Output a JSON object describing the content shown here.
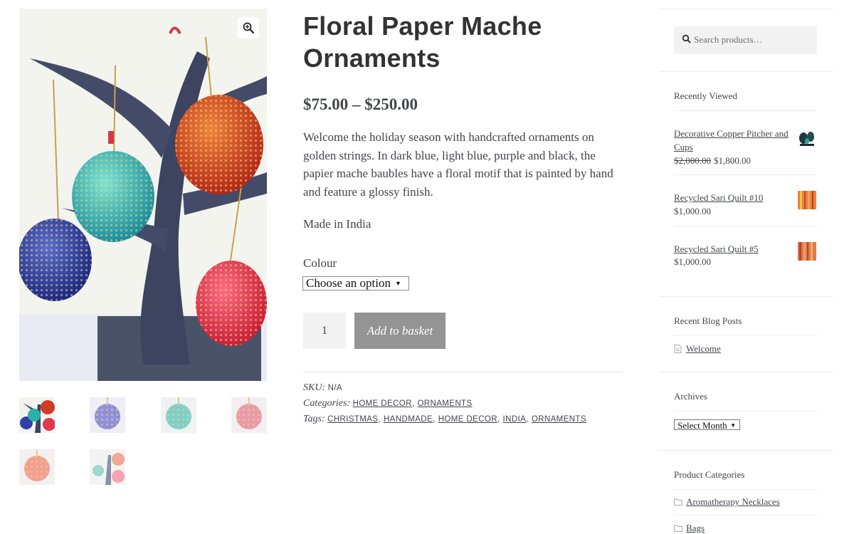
{
  "product": {
    "title_line1": "Floral Paper Mache",
    "title_line2": "Ornaments",
    "price": "$75.00 – $250.00",
    "description": "Welcome the holiday season with handcrafted  ornaments on golden strings. In dark blue, light blue, purple and black, the papier mache baubles have a floral motif that is painted by hand and feature a glossy finish.",
    "made_in": "Made in India",
    "colour_label": "Colour",
    "colour_select_value": "Choose an option",
    "quantity": "1",
    "add_to_basket": "Add to basket",
    "sku_label": "SKU:",
    "sku_value": "N/A",
    "categories_label": "Categories:",
    "categories": [
      "HOME DECOR",
      "ORNAMENTS"
    ],
    "tags_label": "Tags:",
    "tags": [
      "CHRISTMAS",
      "HANDMADE",
      "HOME DECOR",
      "INDIA",
      "ORNAMENTS"
    ]
  },
  "gallery": {
    "zoom_icon": "magnifier-plus-icon",
    "thumbnail_count": 6
  },
  "sidebar": {
    "search_placeholder": "Search products…",
    "recently_viewed": {
      "title": "Recently Viewed",
      "items": [
        {
          "name": "Decorative Copper Pitcher and Cups",
          "old_price": "$2,000.00",
          "price": "$1,800.00"
        },
        {
          "name": "Recycled Sari Quilt #10",
          "price": "$1,000.00"
        },
        {
          "name": "Recycled Sari Quilt #5",
          "price": "$1,000.00"
        }
      ]
    },
    "recent_posts": {
      "title": "Recent Blog Posts",
      "items": [
        "Welcome"
      ]
    },
    "archives": {
      "title": "Archives",
      "select_value": "Select Month"
    },
    "product_categories": {
      "title": "Product Categories",
      "items": [
        "Aromatherapy Necklaces",
        "Bags"
      ]
    }
  },
  "colors": {
    "text": "#43454b",
    "heading": "#333333",
    "button_bg": "#949494",
    "input_bg": "#f2f2f2"
  }
}
